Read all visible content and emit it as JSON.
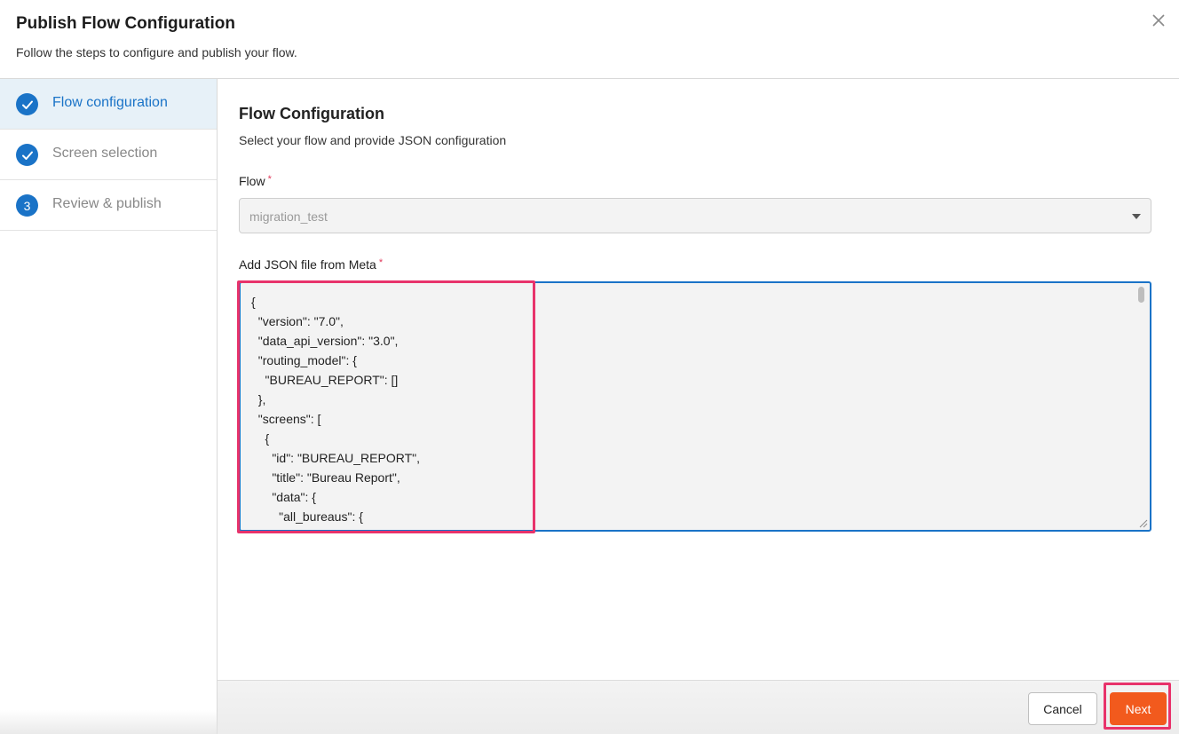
{
  "dialog": {
    "title": "Publish Flow Configuration",
    "subtitle": "Follow the steps to configure and publish your flow.",
    "close_icon": "X"
  },
  "steps": [
    {
      "label": "Flow configuration",
      "state": "completed",
      "active": true,
      "icon": "check-icon"
    },
    {
      "label": "Screen selection",
      "state": "completed",
      "active": false,
      "icon": "check-icon"
    },
    {
      "label": "Review & publish",
      "state": "pending",
      "active": false,
      "number": "3"
    }
  ],
  "main": {
    "title": "Flow Configuration",
    "subtitle": "Select your flow and provide JSON configuration",
    "flow_label": "Flow",
    "flow_required": "*",
    "flow_value": "migration_test",
    "json_label": "Add JSON file from Meta",
    "json_required": "*",
    "json_content": "{\n  \"version\": \"7.0\",\n  \"data_api_version\": \"3.0\",\n  \"routing_model\": {\n    \"BUREAU_REPORT\": []\n  },\n  \"screens\": [\n    {\n      \"id\": \"BUREAU_REPORT\",\n      \"title\": \"Bureau Report\",\n      \"data\": {\n        \"all_bureaus\": {\n          \"type\": \"array\","
  },
  "footer": {
    "cancel_label": "Cancel",
    "next_label": "Next"
  },
  "colors": {
    "accent": "#1a73c7",
    "primary_button": "#f25a1d",
    "highlight": "#e8336b"
  }
}
